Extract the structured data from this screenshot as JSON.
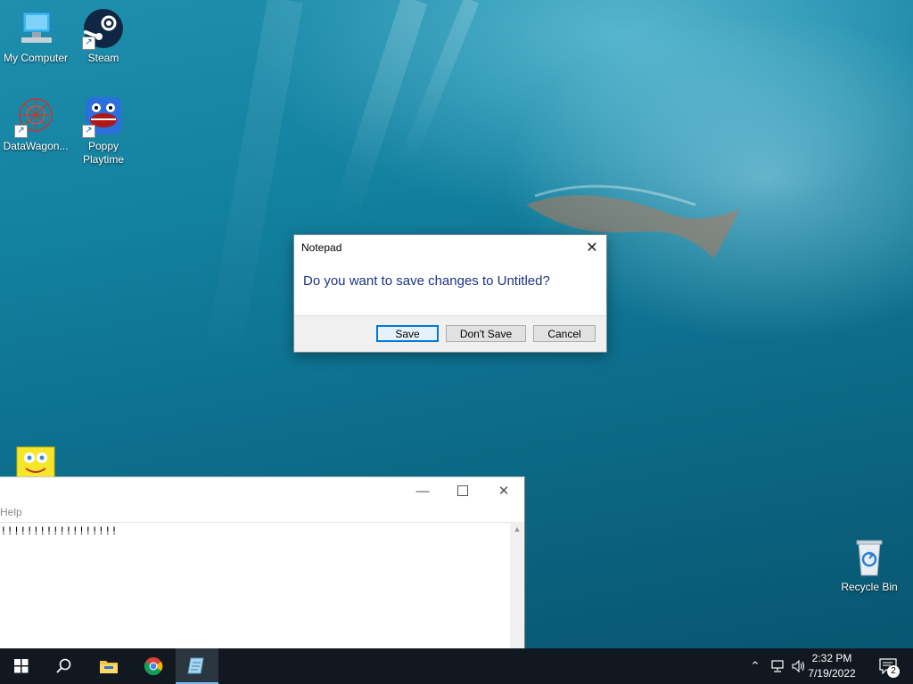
{
  "desktop": {
    "icons": [
      {
        "label": "My Computer"
      },
      {
        "label": "Steam"
      },
      {
        "label": "DataWagon..."
      },
      {
        "label": "Poppy Playtime"
      },
      {
        "label": "Recycle Bin"
      }
    ]
  },
  "dialog": {
    "title": "Notepad",
    "message": "Do you want to save changes to Untitled?",
    "buttons": {
      "save": "Save",
      "dont_save": "Don't Save",
      "cancel": "Cancel"
    }
  },
  "notepad": {
    "menu_visible": "Help",
    "content": "!!!!!!!!!!!!!!!!!!"
  },
  "taskbar": {
    "items": [
      "start-icon",
      "search-icon",
      "file-explorer-icon",
      "chrome-icon",
      "notepad-icon"
    ],
    "active_item": "notepad-icon",
    "clock_time": "2:32 PM",
    "clock_date": "7/19/2022",
    "notification_count": "2"
  },
  "colors": {
    "taskbar": "#11181f",
    "dialog_message": "#1e3287",
    "accent": "#0078d7"
  }
}
